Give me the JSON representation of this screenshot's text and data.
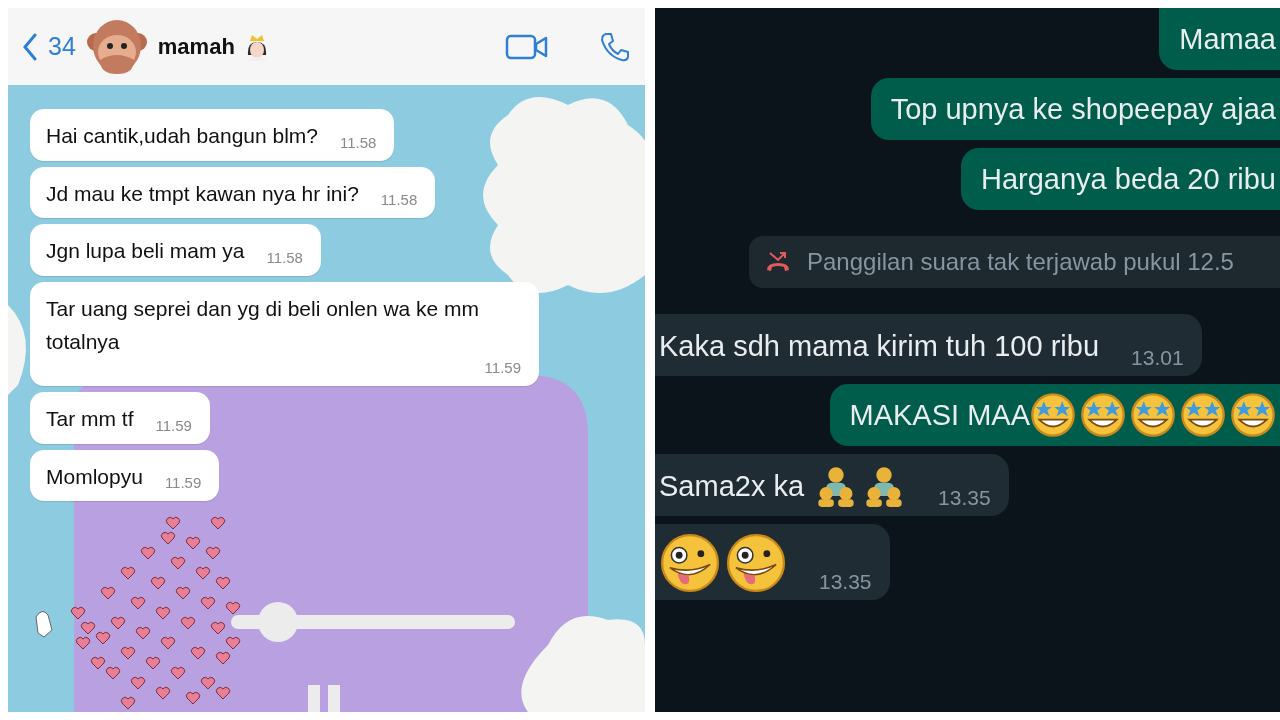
{
  "left_chat": {
    "header": {
      "back_count": "34",
      "contact_name": "mamah"
    },
    "messages": [
      {
        "text": "Hai cantik,udah bangun blm?",
        "time": "11.58"
      },
      {
        "text": "Jd mau ke tmpt kawan nya hr ini?",
        "time": "11.58"
      },
      {
        "text": "Jgn lupa beli mam ya",
        "time": "11.58"
      },
      {
        "text": "Tar uang seprei dan yg di beli onlen wa ke mm totalnya",
        "time": "11.59"
      },
      {
        "text": "Tar mm tf",
        "time": "11.59"
      },
      {
        "text": "Momlopyu",
        "time": "11.59"
      }
    ]
  },
  "right_chat": {
    "messages": [
      {
        "kind": "outgoing",
        "text": "Mamaa"
      },
      {
        "kind": "outgoing",
        "text": "Top upnya ke shopeepay ajaa"
      },
      {
        "kind": "outgoing",
        "text": "Harganya beda 20 ribu"
      },
      {
        "kind": "missed_call",
        "text": "Panggilan suara tak terjawab pukul 12.5"
      },
      {
        "kind": "incoming",
        "text": "Kaka sdh mama kirim tuh 100 ribu",
        "time": "13.01"
      },
      {
        "kind": "outgoing",
        "text": "MAKASI MAA",
        "emojis": [
          {
            "kind": "star_struck"
          },
          {
            "kind": "star_struck"
          },
          {
            "kind": "star_struck"
          },
          {
            "kind": "star_struck"
          },
          {
            "kind": "star_struck"
          }
        ]
      },
      {
        "kind": "incoming",
        "text": "Sama2x ka",
        "time": "13.35",
        "emojis": [
          {
            "kind": "family"
          },
          {
            "kind": "family"
          }
        ]
      },
      {
        "kind": "incoming",
        "time": "13.35",
        "emojis": [
          {
            "kind": "zany"
          },
          {
            "kind": "zany"
          }
        ]
      }
    ]
  }
}
